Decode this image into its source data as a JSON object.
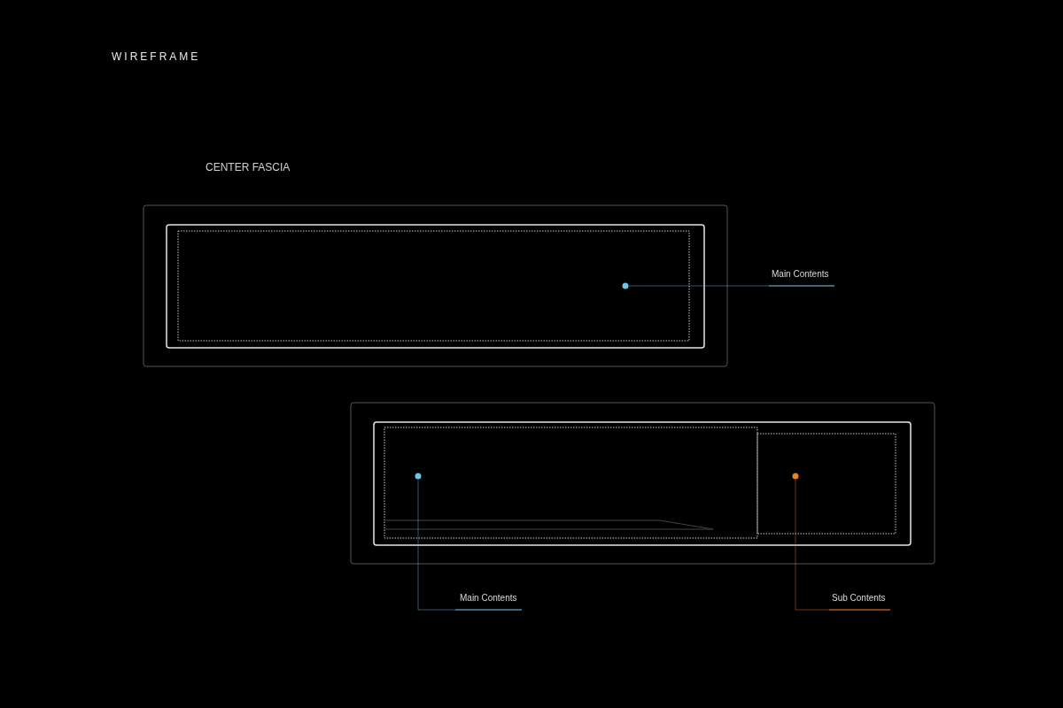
{
  "title": "WIREFRAME",
  "diagrams": [
    {
      "label": "CENTER FASCIA",
      "callouts": [
        {
          "text": "Main Contents",
          "color": "#6ec6e6"
        }
      ]
    },
    {
      "callouts": [
        {
          "text": "Main Contents",
          "color": "#6ec6e6"
        },
        {
          "text": "Sub Contents",
          "color": "#f07f1e"
        }
      ]
    }
  ]
}
